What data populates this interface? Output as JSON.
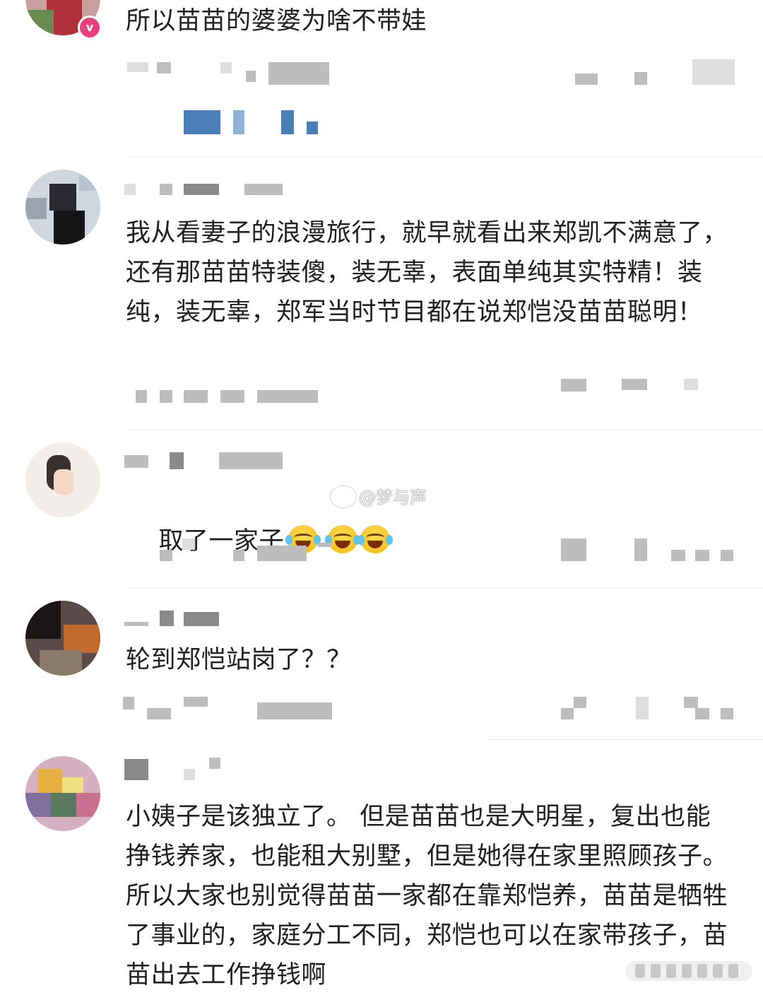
{
  "comments": [
    {
      "text": "所以苗苗的婆婆为啥不带娃",
      "verified": true,
      "badge": "v"
    },
    {
      "text": "我从看妻子的浪漫旅行，就早就看出来郑凯不满意了，还有那苗苗特装傻，装无辜，表面单纯其实特精！装纯，装无辜，郑军当时节目都在说郑恺没苗苗聪明！"
    },
    {
      "text": "取了一家子",
      "emoji": [
        "laugh-cry-emoji",
        "laugh-cry-emoji",
        "laugh-cry-emoji"
      ]
    },
    {
      "text": "轮到郑恺站岗了？？"
    },
    {
      "text": "小姨子是该独立了。 但是苗苗也是大明星，复出也能挣钱养家，也能租大别墅，但是她得在家里照顾孩子。所以大家也别觉得苗苗一家都在靠郑恺养，苗苗是牺牲了事业的，家庭分工不同，郑恺也可以在家带孩子，苗苗出去工作挣钱啊"
    }
  ],
  "watermark": "@梦与声",
  "colors": {
    "text": "#202020",
    "divider": "#ececec",
    "badge": "#e6417a",
    "link": "#4a7fb6"
  }
}
